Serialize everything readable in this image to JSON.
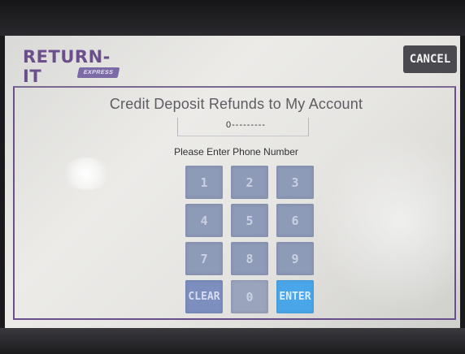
{
  "brand": {
    "logo_text": "RETURN-IT",
    "logo_badge": "EXPRESS"
  },
  "header": {
    "cancel_label": "CANCEL"
  },
  "main": {
    "title": "Credit Deposit Refunds to My Account",
    "phone_value": "0---------",
    "prompt": "Please Enter Phone Number"
  },
  "keypad": {
    "keys": [
      "1",
      "2",
      "3",
      "4",
      "5",
      "6",
      "7",
      "8",
      "9"
    ],
    "clear_label": "CLEAR",
    "zero_label": "0",
    "enter_label": "ENTER"
  },
  "colors": {
    "brand_purple": "#6a4f8c",
    "key_blue": "#8d9ab8",
    "enter_blue": "#4aa6e8",
    "cancel_gray": "#4a4950"
  }
}
